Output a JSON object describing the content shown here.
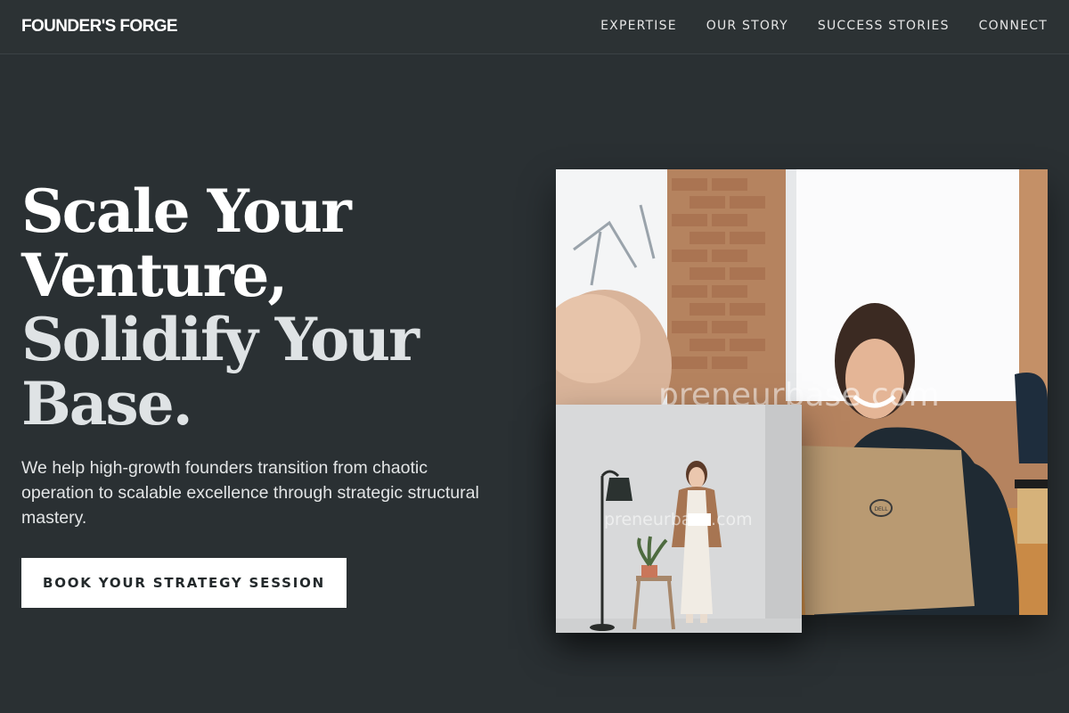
{
  "nav": {
    "logo": "FOUNDER'S FORGE",
    "links": [
      "EXPERTISE",
      "OUR STORY",
      "SUCCESS STORIES",
      "CONNECT"
    ]
  },
  "hero": {
    "headline_lines": [
      "Scale Your",
      "Venture,",
      "Solidify Your",
      "Base."
    ],
    "subtext": "We help high-growth founders transition from chaotic operation to scalable excellence through strategic structural mastery.",
    "cta_label": "BOOK YOUR STRATEGY SESSION"
  },
  "images": {
    "main_watermark": "preneurbase.com",
    "secondary_watermark": "preneurbase.com",
    "laptop_brand": "DELL"
  },
  "colors": {
    "background": "#2a3033",
    "cta_background": "#ffffff",
    "cta_text": "#23292b"
  }
}
